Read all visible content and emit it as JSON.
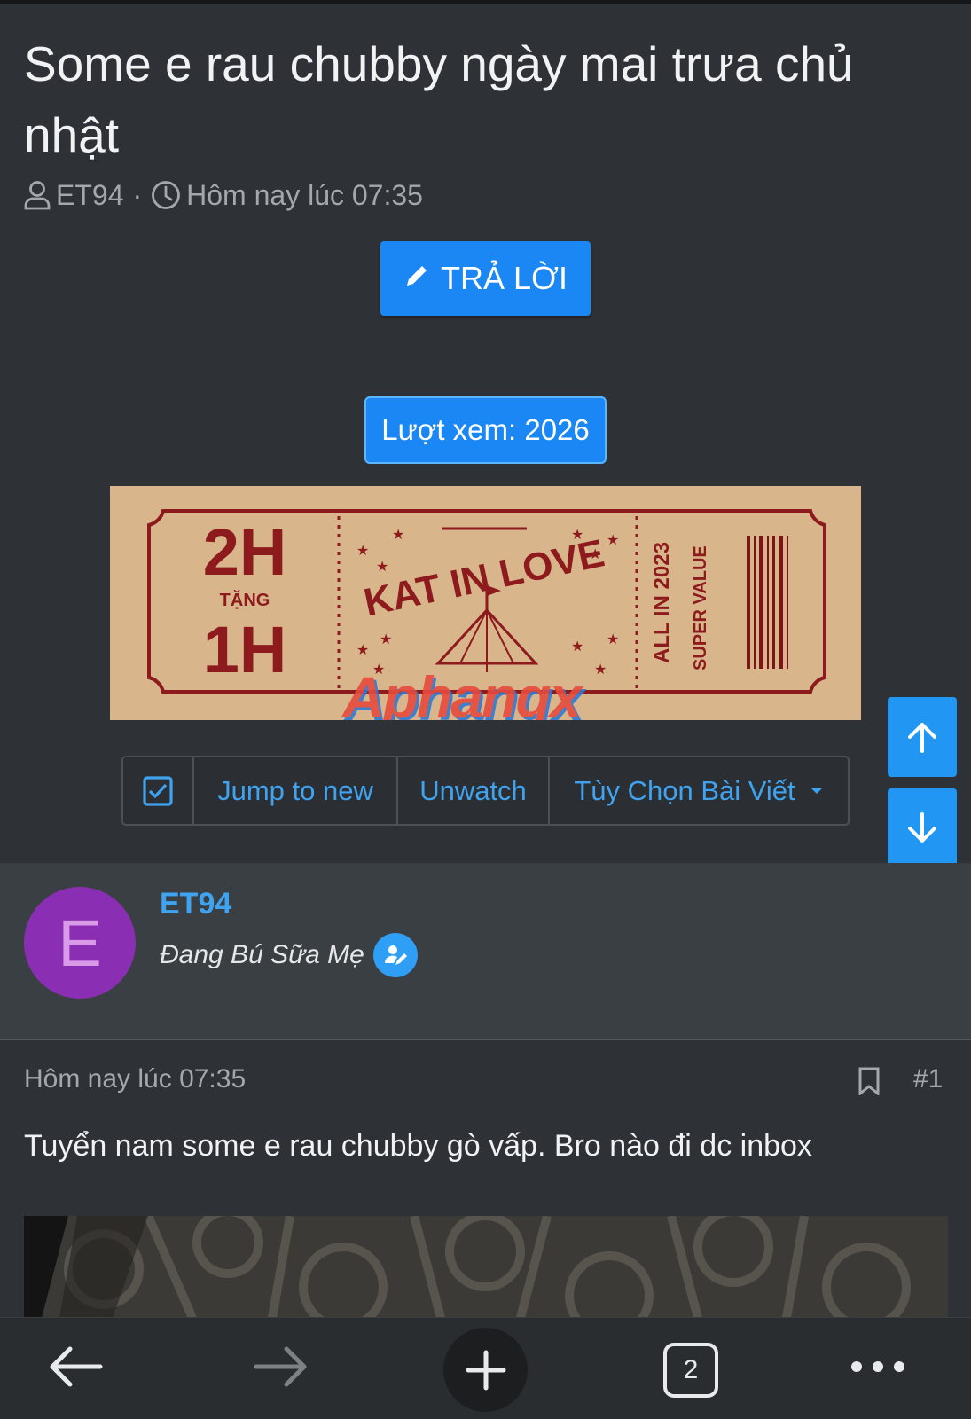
{
  "thread": {
    "title": "Some e rau chubby ngày mai trưa chủ nhật",
    "author": "ET94",
    "separator": "·",
    "timestamp": "Hôm nay lúc 07:35"
  },
  "actions": {
    "reply_label": "TRẢ LỜI",
    "views_label": "Lượt xem: 2026"
  },
  "banner": {
    "top_text": "2H",
    "middle_text": "TẶNG",
    "bottom_text": "1H",
    "arc_text": "KAT IN LOVE",
    "side_text_1": "ALL IN 2023",
    "side_text_2": "SUPER VALUE",
    "watermark": "Aphangx"
  },
  "toolbar": {
    "jump_label": "Jump to new",
    "unwatch_label": "Unwatch",
    "options_label": "Tùy Chọn Bài Viết"
  },
  "user": {
    "avatar_letter": "E",
    "name": "ET94",
    "title": "Đang Bú Sữa Mẹ"
  },
  "post": {
    "date": "Hôm nay lúc 07:35",
    "number": "#1",
    "text": "Tuyển nam some e rau chubby gò vấp. Bro nào đi dc inbox"
  },
  "browser": {
    "tab_count": "2"
  },
  "colors": {
    "accent": "#1a87f5",
    "link": "#3fa3f0",
    "background": "#2e3236",
    "avatar": "#8a2fb3"
  }
}
